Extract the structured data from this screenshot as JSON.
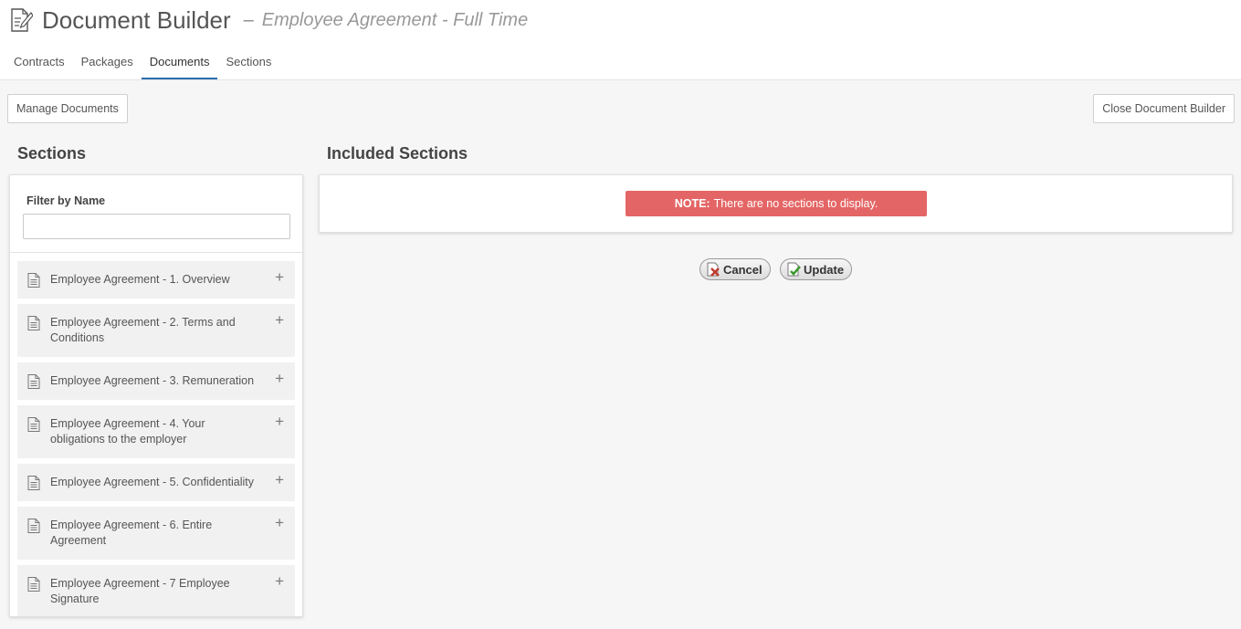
{
  "header": {
    "app_title": "Document Builder",
    "separator": "–",
    "document_name": "Employee Agreement - Full Time",
    "tabs": [
      {
        "label": "Contracts",
        "active": false
      },
      {
        "label": "Packages",
        "active": false
      },
      {
        "label": "Documents",
        "active": true
      },
      {
        "label": "Sections",
        "active": false
      }
    ]
  },
  "toolbar": {
    "manage_documents_label": "Manage Documents",
    "close_builder_label": "Close Document Builder"
  },
  "sections_panel": {
    "heading": "Sections",
    "filter_label": "Filter by Name",
    "filter_value": "",
    "items": [
      {
        "label": "Employee Agreement - 1. Overview"
      },
      {
        "label": "Employee Agreement - 2. Terms and Conditions"
      },
      {
        "label": "Employee Agreement - 3. Remuneration"
      },
      {
        "label": "Employee Agreement - 4. Your obligations to the employer"
      },
      {
        "label": "Employee Agreement - 5. Confidentiality"
      },
      {
        "label": "Employee Agreement - 6. Entire Agreement"
      },
      {
        "label": "Employee Agreement - 7 Employee Signature"
      }
    ]
  },
  "included_panel": {
    "heading": "Included Sections",
    "note_prefix": "NOTE:",
    "note_text": "There are no sections to display."
  },
  "actions": {
    "cancel_label": "Cancel",
    "update_label": "Update"
  },
  "colors": {
    "accent": "#2b6cb0",
    "note_bg": "#e46565"
  },
  "icons": {
    "title": "document-edit-icon",
    "item": "file-text-icon",
    "add": "plus-icon",
    "cancel": "cancel-x-icon",
    "update": "update-check-icon"
  }
}
